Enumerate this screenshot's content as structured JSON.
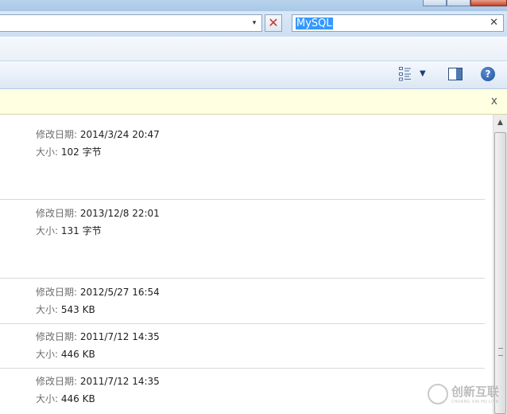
{
  "address_bar": {
    "dropdown_glyph": "▾",
    "clear_glyph": "✕"
  },
  "search": {
    "query": "MySQL",
    "clear_glyph": "✕"
  },
  "toolbar": {
    "help_glyph": "?",
    "view_dropdown_glyph": "▼"
  },
  "info_bar": {
    "close_glyph": "x"
  },
  "results": [
    {
      "modified_label": "修改日期:",
      "modified_value": "2014/3/24 20:47",
      "size_label": "大小:",
      "size_value": "102 字节"
    },
    {
      "modified_label": "修改日期:",
      "modified_value": "2013/12/8 22:01",
      "size_label": "大小:",
      "size_value": "131 字节"
    },
    {
      "modified_label": "修改日期:",
      "modified_value": "2012/5/27 16:54",
      "size_label": "大小:",
      "size_value": "543 KB"
    },
    {
      "modified_label": "修改日期:",
      "modified_value": "2011/7/12 14:35",
      "size_label": "大小:",
      "size_value": "446 KB"
    },
    {
      "modified_label": "修改日期:",
      "modified_value": "2011/7/12 14:35",
      "size_label": "大小:",
      "size_value": "446 KB"
    }
  ],
  "scrollbar": {
    "up_glyph": "▲"
  },
  "watermark": {
    "text": "创新互联",
    "subtext": "CHUANG XIN HU LIAN"
  },
  "icons": [
    "view-options-icon",
    "preview-pane-icon",
    "help-icon",
    "close-icon",
    "dropdown-icon"
  ]
}
